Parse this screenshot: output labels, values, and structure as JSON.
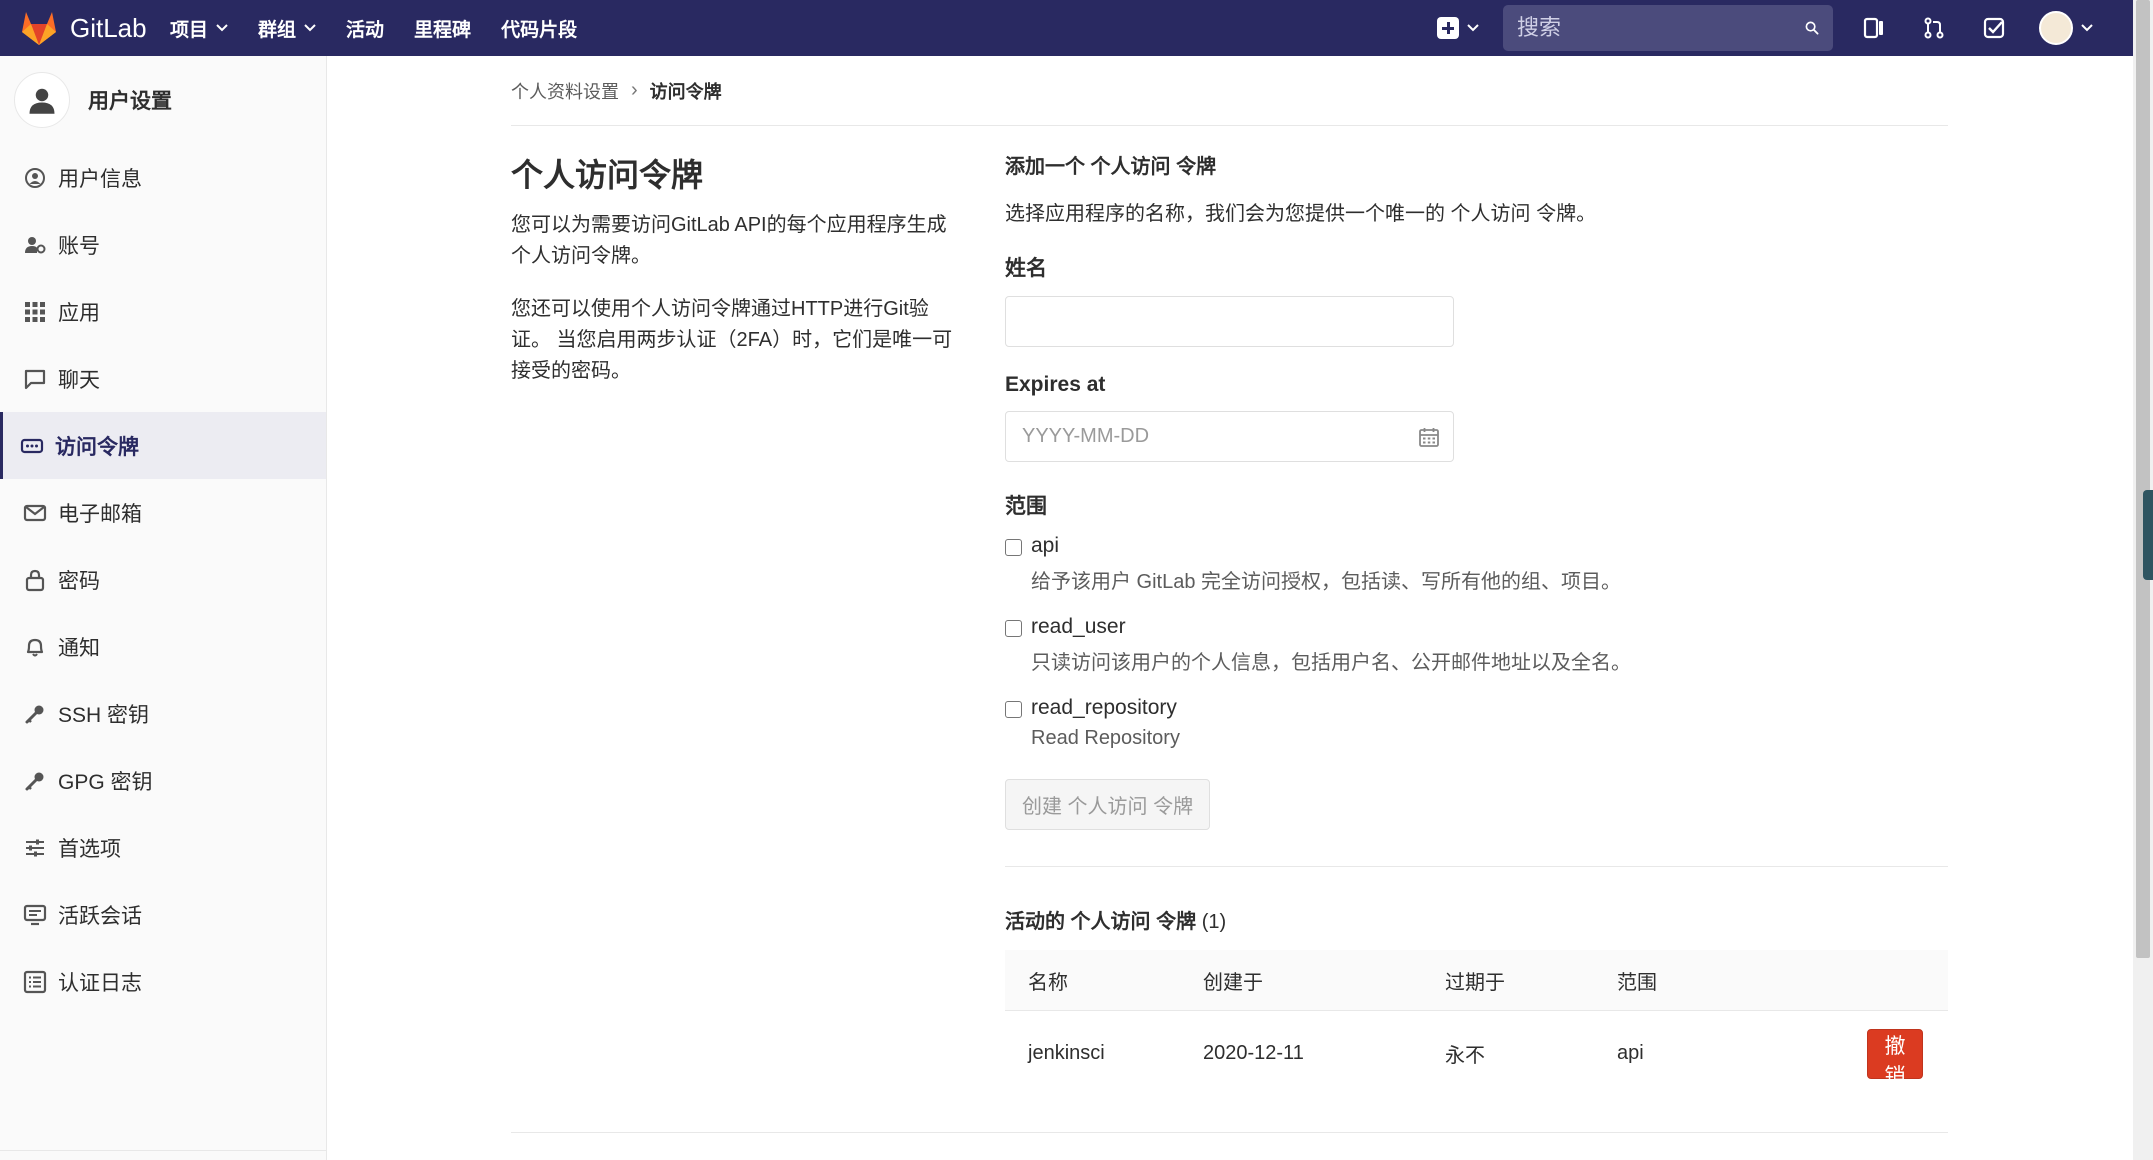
{
  "topnav": {
    "brand": "GitLab",
    "items": [
      {
        "label": "项目",
        "dropdown": true
      },
      {
        "label": "群组",
        "dropdown": true
      },
      {
        "label": "活动",
        "dropdown": false
      },
      {
        "label": "里程碑",
        "dropdown": false
      },
      {
        "label": "代码片段",
        "dropdown": false
      }
    ],
    "search_placeholder": "搜索",
    "colors": {
      "bar": "#292961",
      "accent": "#fc6d26"
    }
  },
  "sidebar": {
    "title": "用户设置",
    "items": [
      {
        "label": "用户信息",
        "icon": "user-circle-icon"
      },
      {
        "label": "账号",
        "icon": "account-icon"
      },
      {
        "label": "应用",
        "icon": "grid-icon"
      },
      {
        "label": "聊天",
        "icon": "chat-icon"
      },
      {
        "label": "访问令牌",
        "icon": "token-icon",
        "active": true
      },
      {
        "label": "电子邮箱",
        "icon": "mail-icon"
      },
      {
        "label": "密码",
        "icon": "lock-icon"
      },
      {
        "label": "通知",
        "icon": "bell-icon"
      },
      {
        "label": "SSH 密钥",
        "icon": "key-icon"
      },
      {
        "label": "GPG 密钥",
        "icon": "key-icon"
      },
      {
        "label": "首选项",
        "icon": "sliders-icon"
      },
      {
        "label": "活跃会话",
        "icon": "monitor-icon"
      },
      {
        "label": "认证日志",
        "icon": "list-icon"
      }
    ]
  },
  "breadcrumb": {
    "parent": "个人资料设置",
    "current": "访问令牌"
  },
  "intro": {
    "heading": "个人访问令牌",
    "para1": "您可以为需要访问GitLab API的每个应用程序生成个人访问令牌。",
    "para2": "您还可以使用个人访问令牌通过HTTP进行Git验证。 当您启用两步认证（2FA）时，它们是唯一可接受的密码。"
  },
  "form": {
    "title": "添加一个 个人访问 令牌",
    "description": "选择应用程序的名称，我们会为您提供一个唯一的 个人访问 令牌。",
    "name_label": "姓名",
    "name_value": "",
    "expires_label": "Expires at",
    "expires_placeholder": "YYYY-MM-DD",
    "scope_label": "范围",
    "scopes": [
      {
        "name": "api",
        "desc": "给予该用户 GitLab 完全访问授权，包括读、写所有他的组、项目。"
      },
      {
        "name": "read_user",
        "desc": "只读访问该用户的个人信息，包括用户名、公开邮件地址以及全名。"
      },
      {
        "name": "read_repository",
        "desc": "Read Repository"
      }
    ],
    "submit_label": "创建 个人访问 令牌"
  },
  "active_tokens": {
    "title": "活动的 个人访问 令牌",
    "count": "(1)",
    "headers": [
      "名称",
      "创建于",
      "过期于",
      "范围"
    ],
    "rows": [
      {
        "name": "jenkinsci",
        "created": "2020-12-11",
        "expires": "永不",
        "scopes": "api",
        "action": "撤销"
      }
    ],
    "revoke_color": "#db3b21"
  }
}
